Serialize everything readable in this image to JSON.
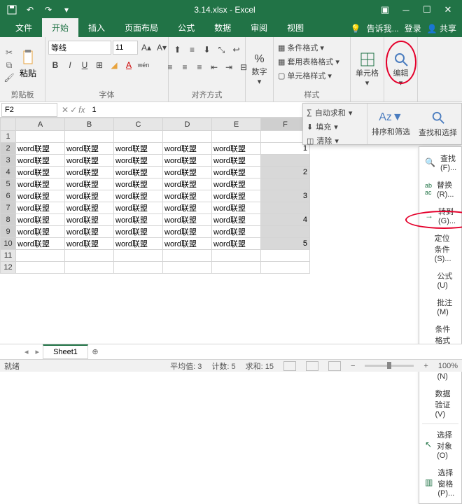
{
  "title": "3.14.xlsx - Excel",
  "tabs": {
    "file": "文件",
    "home": "开始",
    "insert": "插入",
    "layout": "页面布局",
    "formulas": "公式",
    "data": "数据",
    "review": "审阅",
    "view": "视图",
    "tell": "告诉我...",
    "login": "登录",
    "share": "共享"
  },
  "ribbon": {
    "clipboard": {
      "paste": "粘贴",
      "label": "剪贴板"
    },
    "font": {
      "name": "等线",
      "size": "11",
      "label": "字体"
    },
    "align": {
      "label": "对齐方式"
    },
    "number": {
      "btn": "数字",
      "label": ""
    },
    "styles": {
      "cond": "条件格式",
      "table": "套用表格格式",
      "cell": "单元格样式",
      "label": "样式"
    },
    "cells": {
      "btn": "单元格"
    },
    "editing": {
      "btn": "编辑"
    }
  },
  "editpanel": {
    "autosum": "自动求和",
    "fill": "填充",
    "clear": "清除",
    "sort": "排序和筛选",
    "find": "查找和选择"
  },
  "menu": {
    "find": "查找(F)...",
    "replace": "替换(R)...",
    "goto": "转到(G)...",
    "special": "定位条件(S)...",
    "formulas": "公式(U)",
    "comments": "批注(M)",
    "condfmt": "条件格式(C)",
    "constants": "常量(N)",
    "validation": "数据验证(V)",
    "selobj": "选择对象(O)",
    "selpane": "选择窗格(P)..."
  },
  "namebox": "F2",
  "formula": "1",
  "cols": [
    "A",
    "B",
    "C",
    "D",
    "E",
    "F"
  ],
  "rows": [
    1,
    2,
    3,
    4,
    5,
    6,
    7,
    8,
    9,
    10,
    11,
    12
  ],
  "celltext": "word联盟",
  "fvals": {
    "2": "1",
    "4": "2",
    "6": "3",
    "8": "4",
    "10": "5"
  },
  "sheet": "Sheet1",
  "status": {
    "ready": "就绪",
    "avg": "平均值: 3",
    "count": "计数: 5",
    "sum": "求和: 15",
    "zoom": "100%"
  }
}
